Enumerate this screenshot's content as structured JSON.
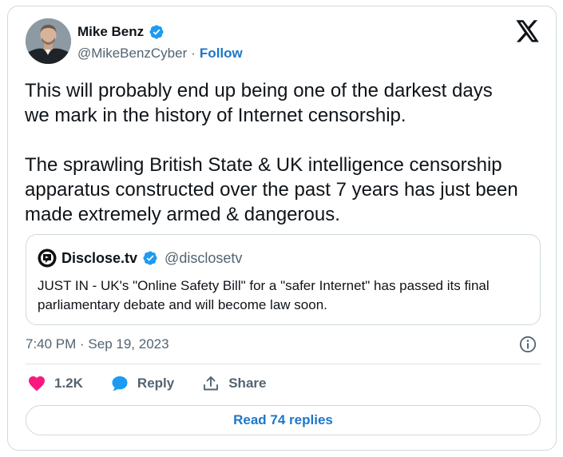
{
  "author": {
    "name": "Mike Benz",
    "handle": "@MikeBenzCyber",
    "separator": "·",
    "follow_label": "Follow"
  },
  "tweet": {
    "paragraph_1": "This will probably end up being one of the darkest days\nwe mark in the history of Internet censorship.",
    "paragraph_2": "The sprawling British State & UK intelligence censorship\napparatus constructed over the past 7 years has just been\nmade extremely armed & dangerous."
  },
  "quote": {
    "name": "Disclose.tv",
    "handle": "@disclosetv",
    "text": "JUST IN - UK's \"Online Safety Bill\" for a \"safer Internet\" has passed its final parliamentary debate and will become law soon."
  },
  "meta": {
    "timestamp": "7:40 PM · Sep 19, 2023"
  },
  "actions": {
    "like_count": "1.2K",
    "reply_label": "Reply",
    "share_label": "Share"
  },
  "read_replies_label": "Read 74 replies",
  "colors": {
    "accent": "#1d77c9",
    "verified": "#1d9bf0",
    "like": "#f91880",
    "muted": "#536471"
  },
  "icons": {
    "verified": "verified-badge-icon",
    "x_logo": "x-logo-icon",
    "info": "info-icon",
    "like": "heart-icon",
    "reply": "speech-bubble-icon",
    "share": "share-upload-icon"
  }
}
